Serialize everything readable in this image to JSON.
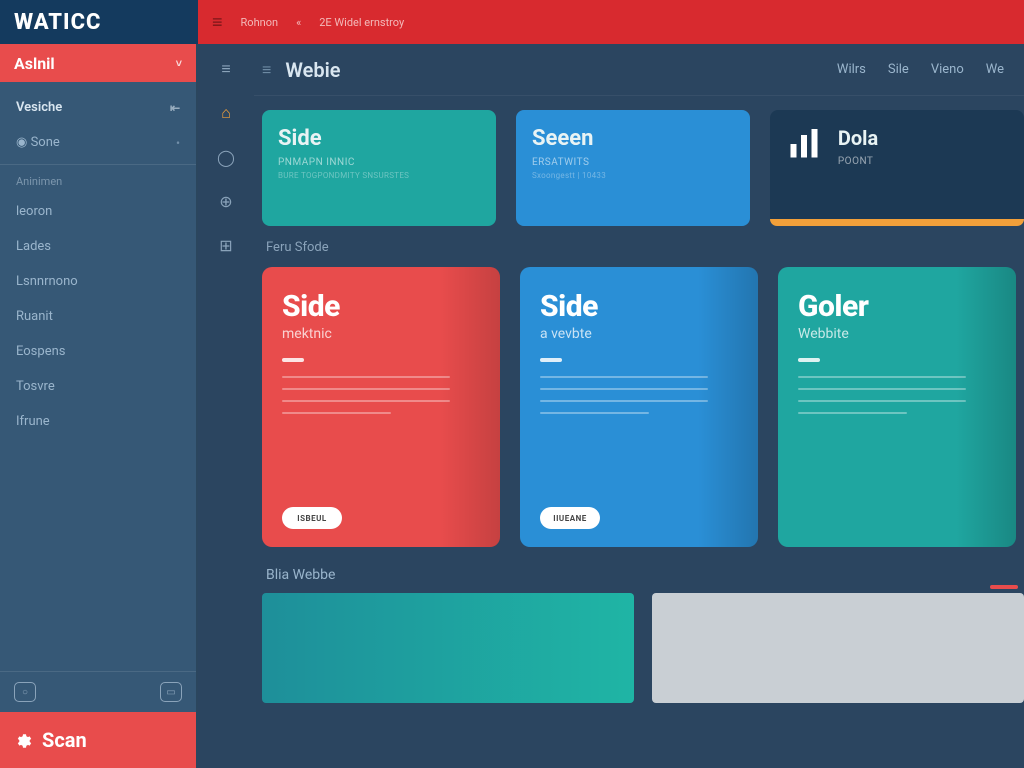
{
  "colors": {
    "brand_red": "#d82a2f",
    "brand_red2": "#e84c4c",
    "teal": "#1fa6a0",
    "blue": "#2a8fd6",
    "dark": "#1c3954",
    "bg": "#2b4560",
    "accent": "#f2a03a"
  },
  "topbar": {
    "logo": "WATICC",
    "breadcrumb1": "Rohnon",
    "breadcrumb_sep": "«",
    "breadcrumb2": "2E Widel ernstroy"
  },
  "sidebar_a": {
    "section": "Aslnil",
    "primary": "Vesiche",
    "item_sone": "Sone",
    "group1": "Aninimen",
    "items": [
      "leoron",
      "Lades",
      "Lsnnrnono",
      "Ruanit",
      "Eospens",
      "Tosvre",
      "Ifrune"
    ],
    "scan": "Scan"
  },
  "main": {
    "title": "Webie",
    "tabs": [
      "Wilrs",
      "Sile",
      "Vieno",
      "We"
    ]
  },
  "cards_small": [
    {
      "title": "Side",
      "sub": "Pnmapn innic",
      "sub2": "BURE TOGPONDMITY SNSURSTES"
    },
    {
      "title": "Seeen",
      "sub": "Ersatwits",
      "sub2": "Sxoongestt | 10433"
    },
    {
      "title": "Dola",
      "sub": "Poont"
    }
  ],
  "section1": "Feru Sfode",
  "cards_large": [
    {
      "title": "Side",
      "meta": "mektnic",
      "button": "ISBEUL"
    },
    {
      "title": "Side",
      "meta": "a vevbte",
      "button": "IIUEANE"
    },
    {
      "title": "Goler",
      "meta": "Webbite",
      "button": ""
    }
  ],
  "section2": "Blia Webbe"
}
